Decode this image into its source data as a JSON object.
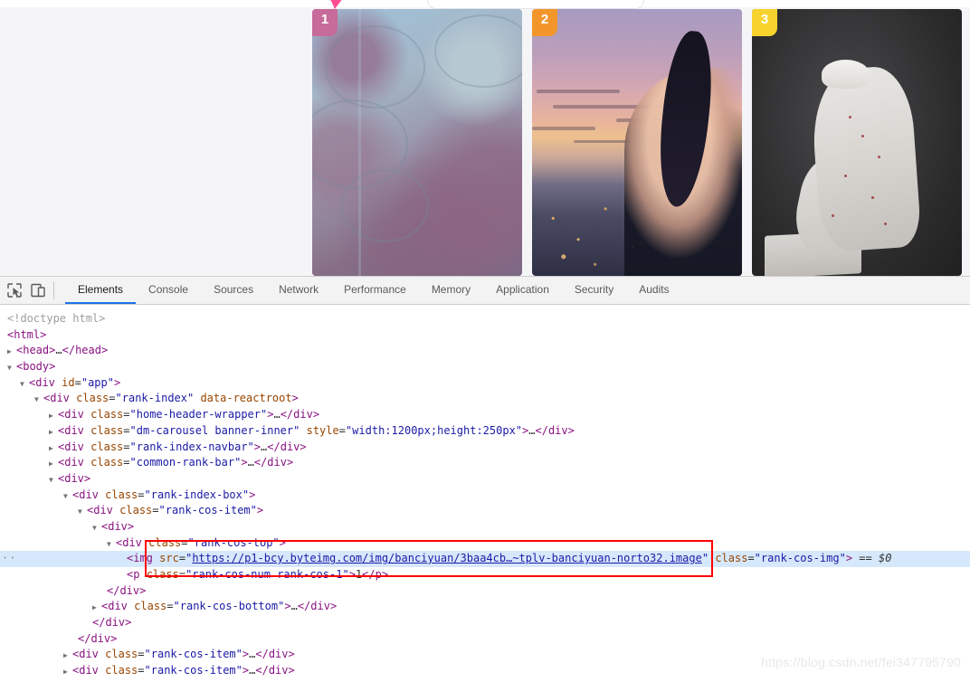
{
  "page": {
    "cards": [
      {
        "badge": "1",
        "badge_color": "#c76b9a",
        "name": "rank-card-1"
      },
      {
        "badge": "2",
        "badge_color": "#f2962b",
        "name": "rank-card-2"
      },
      {
        "badge": "3",
        "badge_color": "#f6d32d",
        "name": "rank-card-3"
      }
    ],
    "highlight_color": "#6fa8dc"
  },
  "devtools": {
    "toolbar": {
      "inspect_icon": "inspect-element-icon",
      "device_icon": "device-toolbar-icon"
    },
    "tabs": [
      {
        "label": "Elements",
        "active": true
      },
      {
        "label": "Console",
        "active": false
      },
      {
        "label": "Sources",
        "active": false
      },
      {
        "label": "Network",
        "active": false
      },
      {
        "label": "Performance",
        "active": false
      },
      {
        "label": "Memory",
        "active": false
      },
      {
        "label": "Application",
        "active": false
      },
      {
        "label": "Security",
        "active": false
      },
      {
        "label": "Audits",
        "active": false
      }
    ],
    "dom": {
      "l0": "<!doctype html>",
      "l1_tag": "html",
      "l2_tag": "head",
      "l3_tag": "body",
      "l4_tag": "div",
      "l4_attr": "id",
      "l4_val": "\"app\"",
      "l5_attr": "class",
      "l5_val": "\"rank-index\"",
      "l5_attr2": "data-reactroot",
      "l6_val": "\"home-header-wrapper\"",
      "l7_val": "\"dm-carousel banner-inner\"",
      "l7_attr2": "style",
      "l7_val2": "\"width:1200px;height:250px\"",
      "l8_val": "\"rank-index-navbar\"",
      "l9_val": "\"common-rank-bar\"",
      "l11_val": "\"rank-index-box\"",
      "l12_val": "\"rank-cos-item\"",
      "l14_val": "\"rank-cos-top\"",
      "img_tag": "img",
      "img_attr": "src",
      "img_url": "https://p1-bcy.byteimg.com/img/banciyuan/3baa4cb…~tplv-banciyuan-norto32.image",
      "img_class_attr": "class",
      "img_class_val": "\"rank-cos-img\"",
      "img_suffix": "== $0",
      "p_tag": "p",
      "p_class": "\"rank-cos-num rank-cos-1\"",
      "p_text": "1",
      "bottom_val": "\"rank-cos-bottom\"",
      "item_val": "\"rank-cos-item\"",
      "ellipsis": "…",
      "dots_marker": "··"
    }
  },
  "watermark": "https://blog.csdn.net/fei347795790"
}
